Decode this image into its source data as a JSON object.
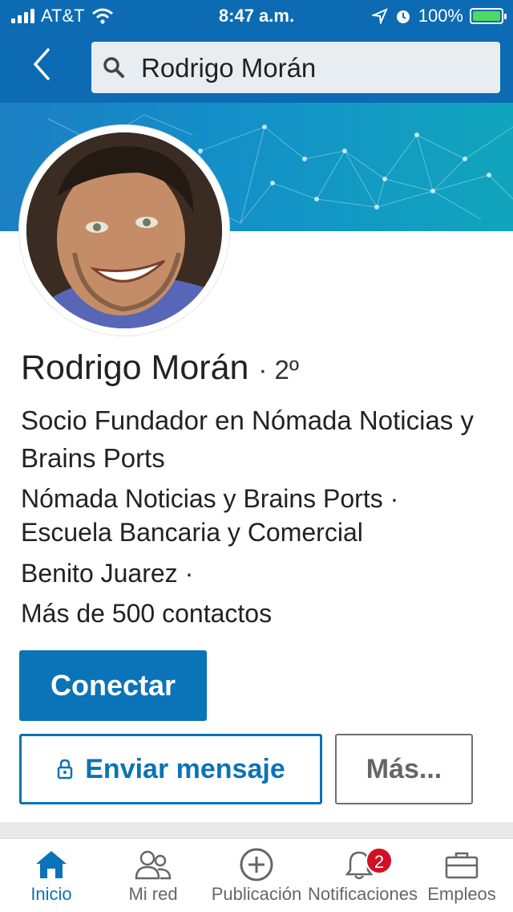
{
  "status_bar": {
    "carrier": "AT&T",
    "time": "8:47 a.m.",
    "battery": "100%"
  },
  "nav": {
    "search_value": "Rodrigo Morán"
  },
  "profile": {
    "name": "Rodrigo Morán",
    "degree": "· 2º",
    "headline": "Socio Fundador en Nómada Noticias y Brains Ports",
    "companies": "Nómada Noticias y Brains Ports · Escuela Bancaria y Comercial",
    "location": "Benito Juarez ·",
    "connections": "Más de 500 contactos"
  },
  "actions": {
    "connect_label": "Conectar",
    "message_label": "Enviar mensaje",
    "more_label": "Más..."
  },
  "tabs": [
    {
      "label": "Inicio",
      "icon": "home-icon",
      "active": true
    },
    {
      "label": "Mi red",
      "icon": "network-icon"
    },
    {
      "label": "Publicación",
      "icon": "post-plus-icon"
    },
    {
      "label": "Notificaciones",
      "icon": "bell-icon",
      "badge": "2"
    },
    {
      "label": "Empleos",
      "icon": "briefcase-icon"
    }
  ],
  "colors": {
    "brand": "#0b73b7",
    "badge": "#d11124"
  }
}
